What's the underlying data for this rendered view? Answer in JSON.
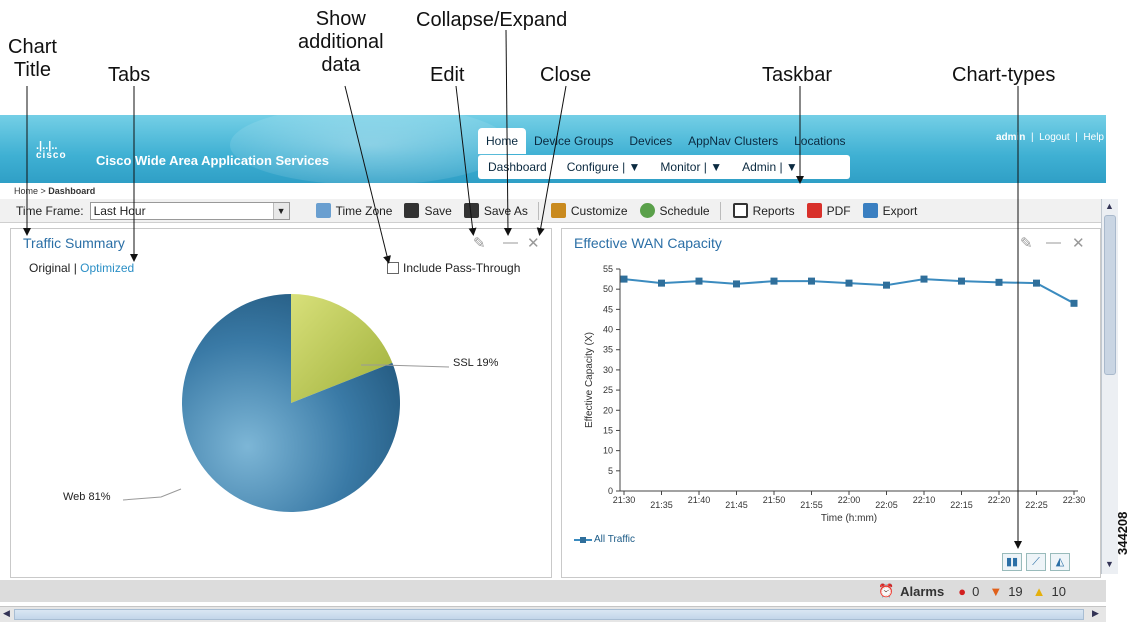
{
  "callouts": {
    "chart_title": "Chart\nTitle",
    "tabs": "Tabs",
    "show_data": "Show\nadditional\ndata",
    "edit": "Edit",
    "collapse": "Collapse/Expand",
    "close": "Close",
    "taskbar": "Taskbar",
    "chart_types": "Chart-types"
  },
  "header": {
    "brand": "cisco",
    "app_title": "Cisco Wide Area Application Services",
    "nav": [
      "Home",
      "Device Groups",
      "Devices",
      "AppNav Clusters",
      "Locations"
    ],
    "subnav": [
      "Dashboard",
      "Configure | ▼",
      "Monitor | ▼",
      "Admin | ▼"
    ],
    "user": "admin",
    "logout": "Logout",
    "help": "Help"
  },
  "breadcrumb": {
    "home": "Home",
    "current": "Dashboard"
  },
  "toolbar": {
    "time_frame_label": "Time Frame:",
    "time_frame_value": "Last Hour",
    "buttons": [
      "Time Zone",
      "Save",
      "Save As",
      "Customize",
      "Schedule",
      "Reports",
      "PDF",
      "Export"
    ]
  },
  "left_panel": {
    "title": "Traffic Summary",
    "tab_original": "Original",
    "tab_optimized": "Optimized",
    "passthrough": "Include Pass-Through",
    "ssl_label": "SSL 19%",
    "web_label": "Web 81%"
  },
  "right_panel": {
    "title": "Effective WAN Capacity",
    "ylabel": "Effective Capacity (X)",
    "xlabel": "Time (h:mm)",
    "legend": "All Traffic"
  },
  "statusbar": {
    "alarms": "Alarms",
    "critical": "0",
    "major": "19",
    "minor": "10"
  },
  "figure_id": "344208",
  "colors": {
    "header": "#3fb0d3",
    "pie_web": "#2f6f9b",
    "pie_ssl": "#c4d14a",
    "line": "#3b8bbf"
  },
  "chart_data": [
    {
      "type": "pie",
      "categories": [
        "SSL",
        "Web"
      ],
      "values": [
        19,
        81
      ]
    },
    {
      "type": "line",
      "xlabel": "Time (h:mm)",
      "ylabel": "Effective Capacity (X)",
      "categories": [
        "21:30",
        "21:35",
        "21:40",
        "21:45",
        "21:50",
        "21:55",
        "22:00",
        "22:05",
        "22:10",
        "22:15",
        "22:20",
        "22:25",
        "22:30"
      ],
      "series": [
        {
          "name": "All Traffic",
          "values": [
            52.5,
            51.5,
            52,
            51.3,
            52,
            52,
            51.5,
            51,
            52.5,
            52,
            51.7,
            51.5,
            46.5
          ]
        }
      ],
      "ylim": [
        0,
        55
      ],
      "yticks": [
        0,
        5,
        10,
        15,
        20,
        25,
        30,
        35,
        40,
        45,
        50,
        55
      ],
      "grid": false,
      "legend": "bottom-left"
    }
  ]
}
